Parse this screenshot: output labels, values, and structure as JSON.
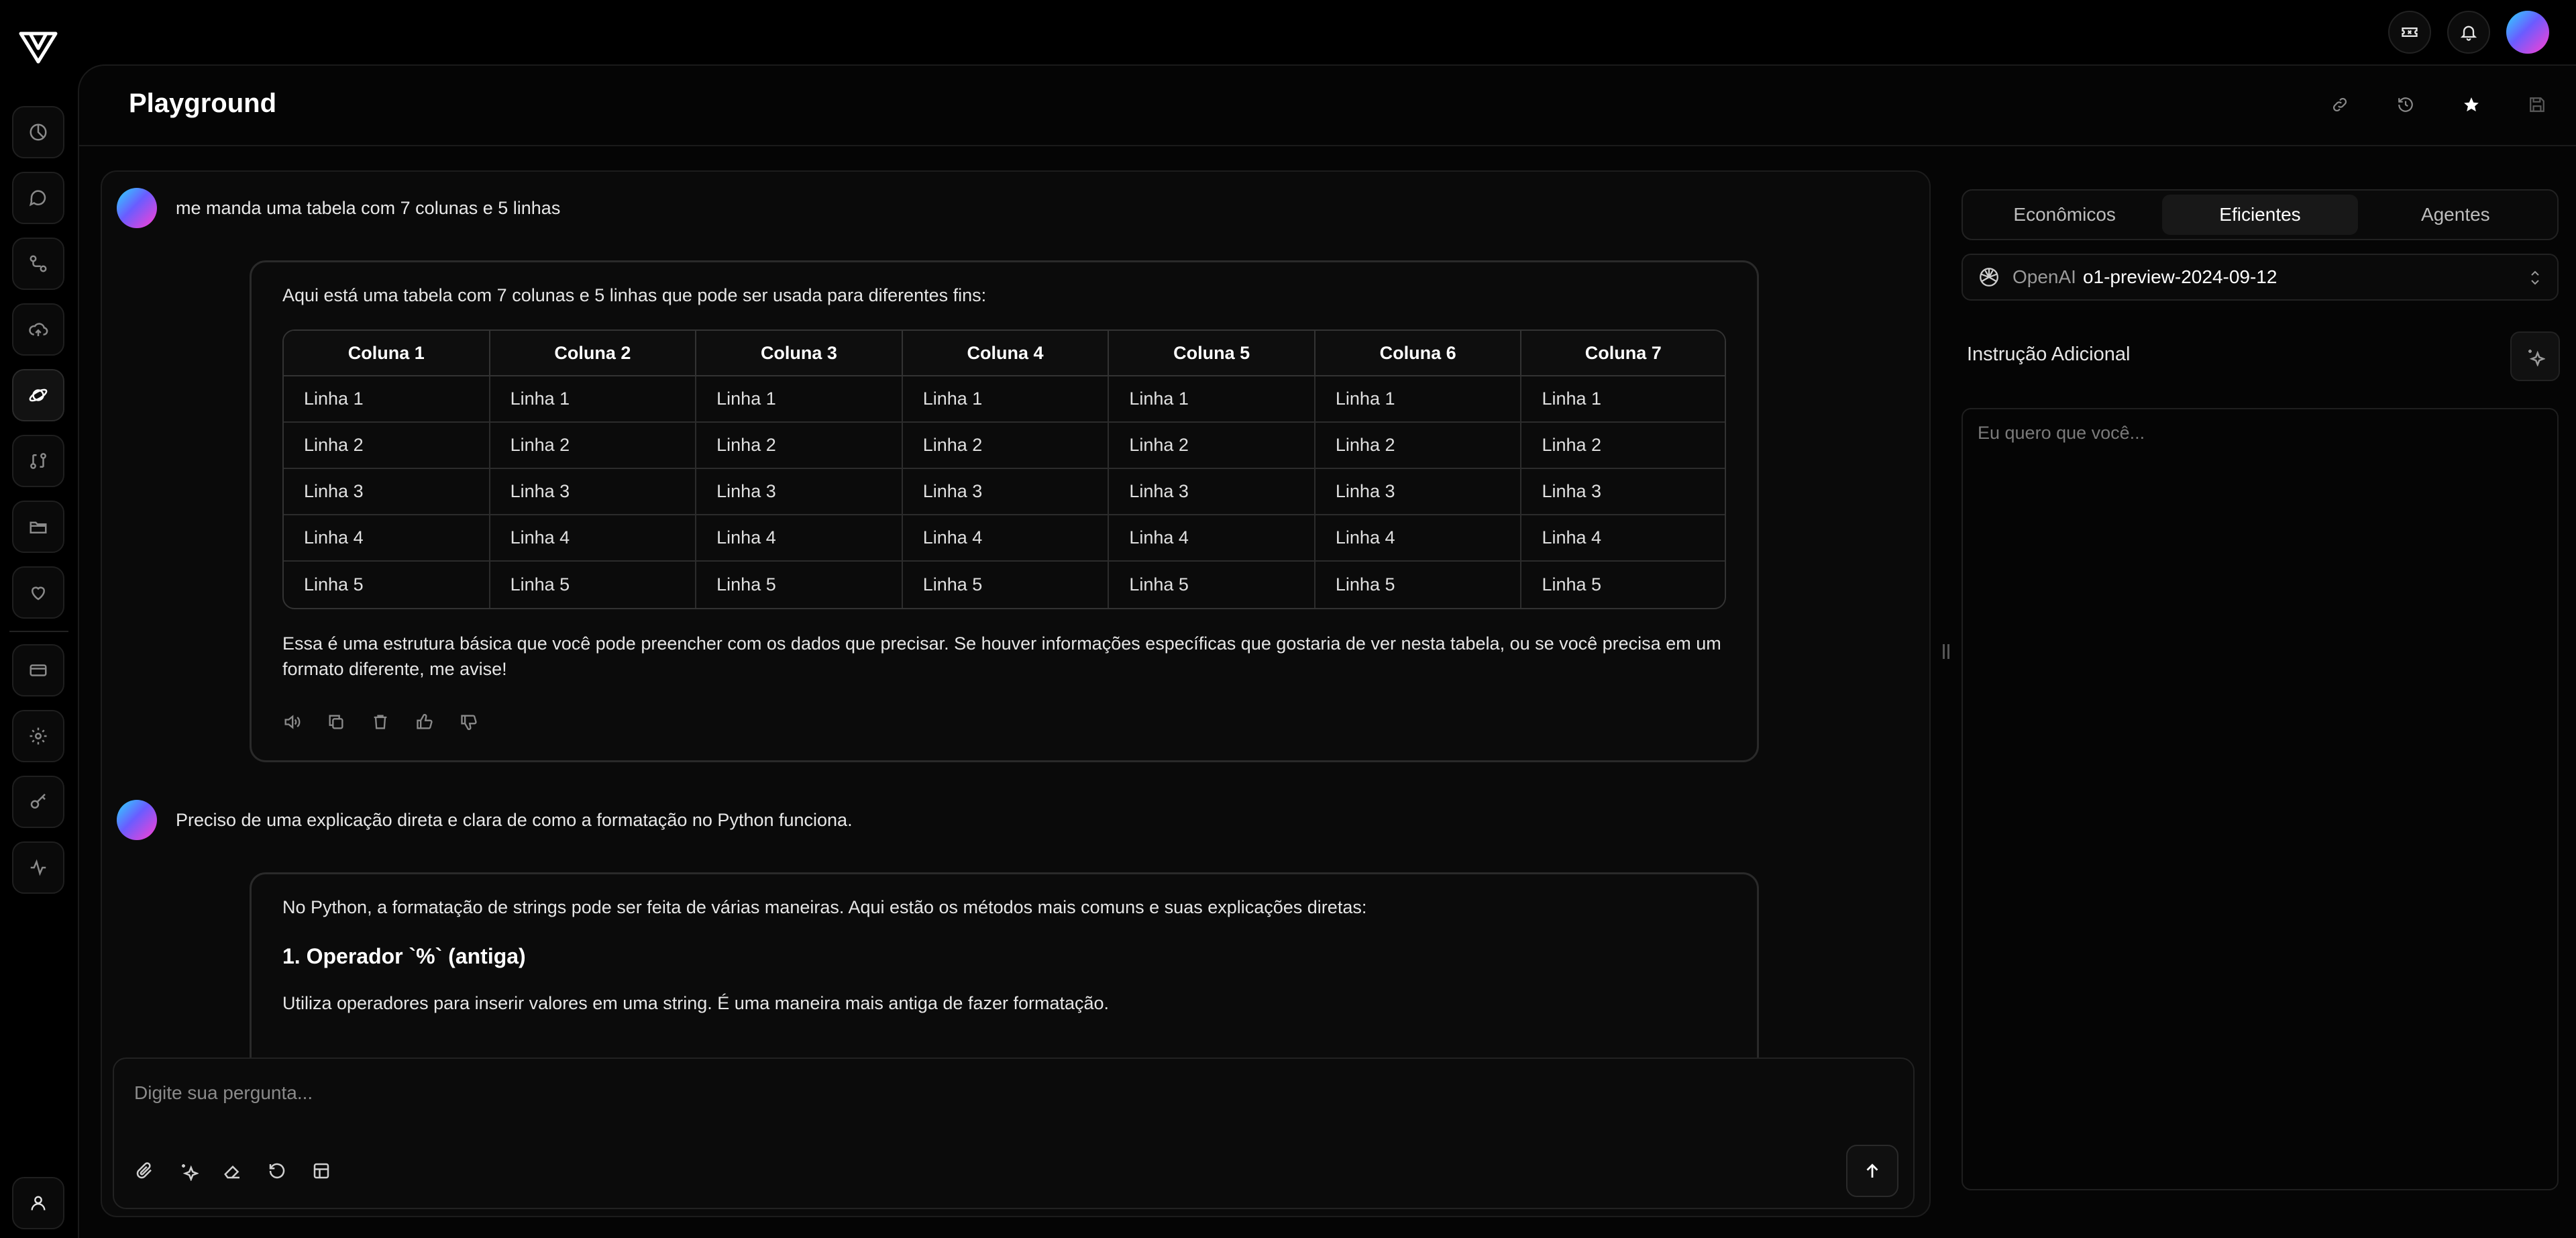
{
  "app": {
    "title": "Playground"
  },
  "chat": {
    "messages": [
      {
        "user": "me manda uma tabela com 7 colunas e 5 linhas",
        "reply_intro": "Aqui está uma tabela com 7 colunas e 5 linhas que pode ser usada para diferentes fins:",
        "table": {
          "headers": [
            "Coluna 1",
            "Coluna 2",
            "Coluna 3",
            "Coluna 4",
            "Coluna 5",
            "Coluna 6",
            "Coluna 7"
          ],
          "rows": [
            [
              "Linha 1",
              "Linha 1",
              "Linha 1",
              "Linha 1",
              "Linha 1",
              "Linha 1",
              "Linha 1"
            ],
            [
              "Linha 2",
              "Linha 2",
              "Linha 2",
              "Linha 2",
              "Linha 2",
              "Linha 2",
              "Linha 2"
            ],
            [
              "Linha 3",
              "Linha 3",
              "Linha 3",
              "Linha 3",
              "Linha 3",
              "Linha 3",
              "Linha 3"
            ],
            [
              "Linha 4",
              "Linha 4",
              "Linha 4",
              "Linha 4",
              "Linha 4",
              "Linha 4",
              "Linha 4"
            ],
            [
              "Linha 5",
              "Linha 5",
              "Linha 5",
              "Linha 5",
              "Linha 5",
              "Linha 5",
              "Linha 5"
            ]
          ]
        },
        "reply_outro": "Essa é uma estrutura básica que você pode preencher com os dados que precisar. Se houver informações específicas que gostaria de ver nesta tabela, ou se você precisa em um formato diferente, me avise!"
      },
      {
        "user": "Preciso de uma explicação direta e clara de como a formatação no Python funciona.",
        "reply_intro": "No Python, a formatação de strings pode ser feita de várias maneiras. Aqui estão os métodos mais comuns e suas explicações diretas:",
        "heading": "1. Operador `%` (antiga)",
        "paragraph": "Utiliza operadores para inserir valores em uma string. É uma maneira mais antiga de fazer formatação."
      }
    ],
    "composer": {
      "placeholder": "Digite sua pergunta..."
    }
  },
  "side_panel": {
    "tabs": [
      {
        "label": "Econômicos",
        "active": false
      },
      {
        "label": "Eficientes",
        "active": true
      },
      {
        "label": "Agentes",
        "active": false
      }
    ],
    "model": {
      "provider": "OpenAI",
      "name": "o1-preview-2024-09-12"
    },
    "instruction": {
      "label": "Instrução Adicional",
      "placeholder": "Eu quero que você..."
    }
  },
  "icons": {
    "top": [
      "ticket-icon",
      "bell-icon",
      "profile-avatar"
    ],
    "rail": [
      "chart-pie-icon",
      "chat-icon",
      "workflow-icon",
      "cloud-upload-icon",
      "playground-icon",
      "git-compare-icon",
      "folder-icon",
      "heart-icon",
      "credit-card-icon",
      "settings-icon",
      "key-icon",
      "activity-icon"
    ],
    "header": [
      "link-icon",
      "history-icon",
      "star-icon",
      "save-icon"
    ]
  },
  "colors": {
    "background": "#000000",
    "panel": "#0a0a0a",
    "accent_gradient": [
      "#2bd9ff",
      "#6a5cff",
      "#ff3fd1"
    ]
  }
}
